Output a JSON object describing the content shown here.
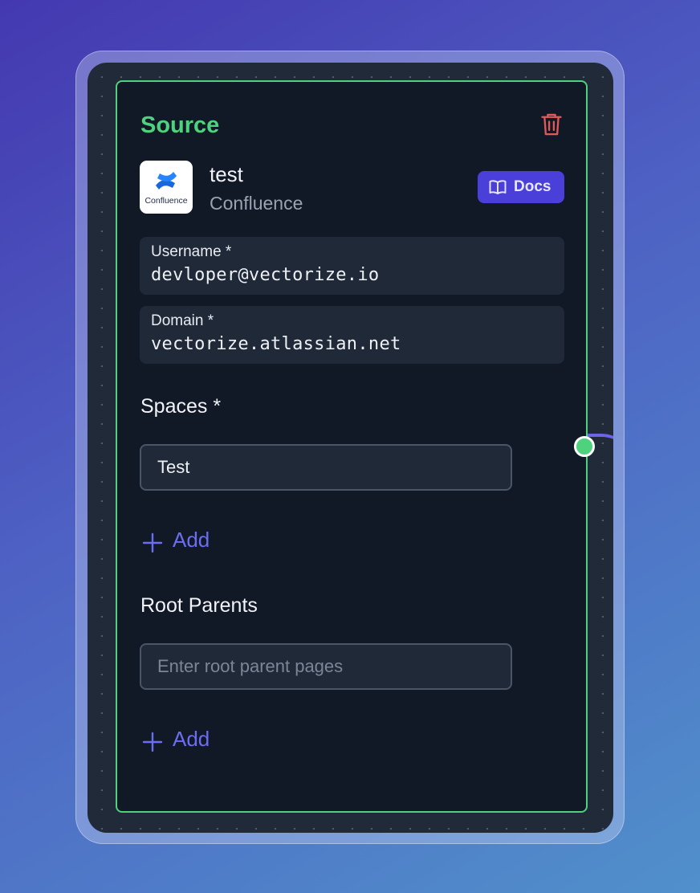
{
  "node": {
    "title": "Source",
    "source_name": "test",
    "source_type": "Confluence",
    "logo_text": "Confluence",
    "docs_label": "Docs"
  },
  "fields": {
    "username": {
      "label": "Username *",
      "value": "devloper@vectorize.io"
    },
    "domain": {
      "label": "Domain *",
      "value": "vectorize.atlassian.net"
    }
  },
  "spaces": {
    "title": "Spaces *",
    "items": [
      "Test"
    ],
    "add_label": "Add"
  },
  "root_parents": {
    "title": "Root Parents",
    "placeholder": "Enter root parent pages",
    "add_label": "Add"
  },
  "icons": {
    "delete": "trash-icon",
    "docs": "book-icon",
    "add": "plus-icon",
    "logo": "confluence-logo"
  },
  "colors": {
    "accent_green": "#4ed27e",
    "brand_purple": "#4a3fd9",
    "link_blue": "#6b6ef0",
    "danger_red": "#e05a5a"
  }
}
